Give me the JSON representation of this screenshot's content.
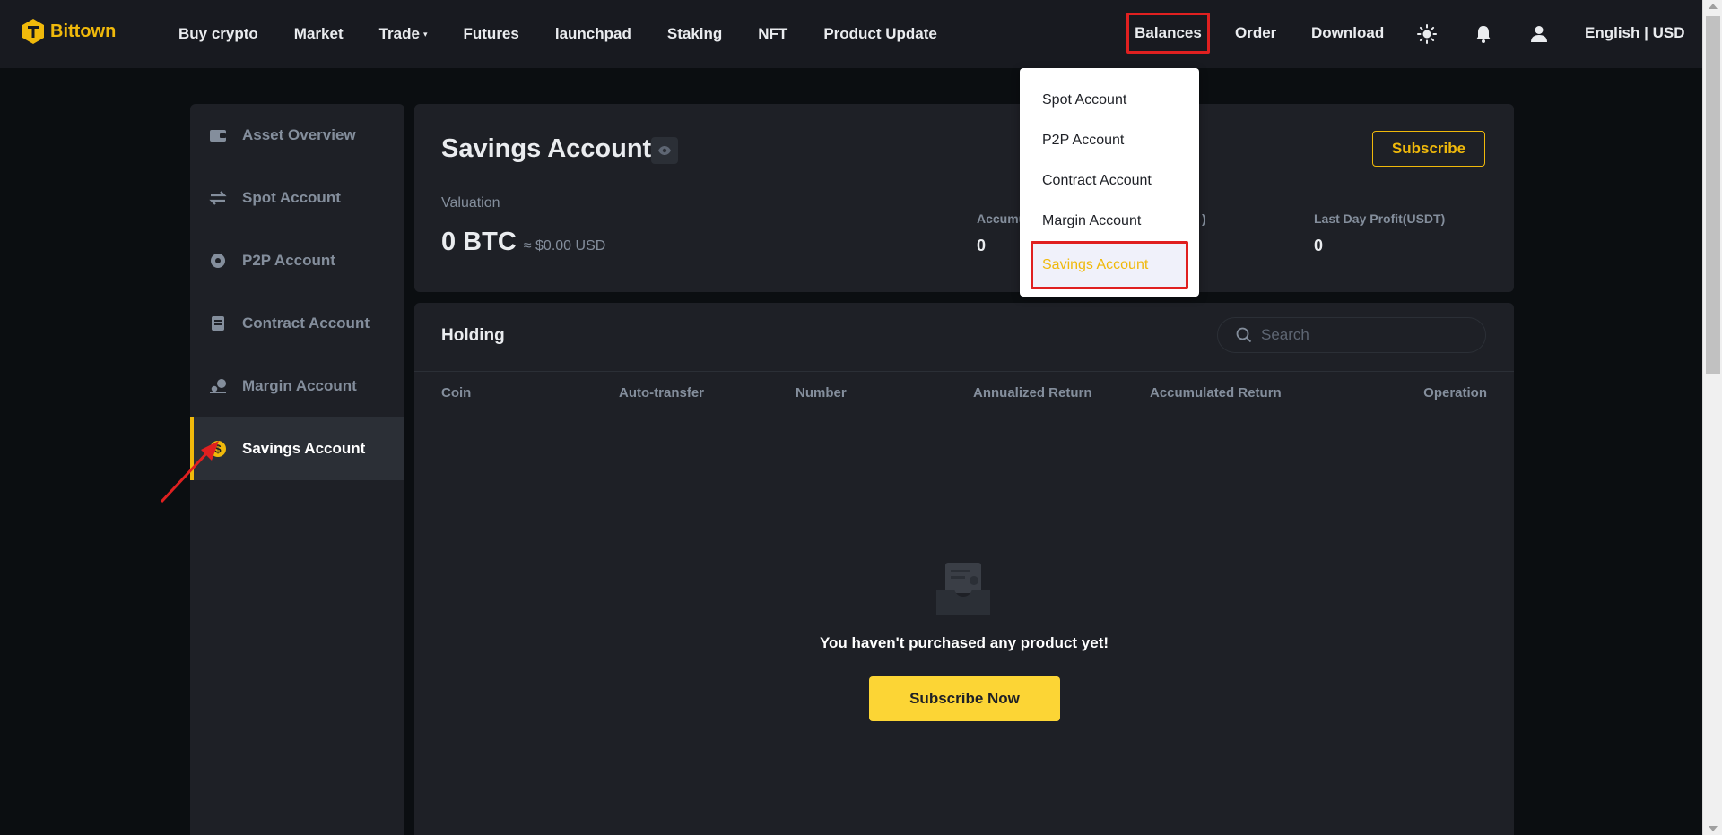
{
  "brand": {
    "name": "Bittown",
    "color": "#f0b90b"
  },
  "nav": {
    "items": [
      "Buy crypto",
      "Market",
      "Trade",
      "Futures",
      "launchpad",
      "Staking",
      "NFT",
      "Product Update"
    ],
    "trade_caret": "▾",
    "right": {
      "balances": "Balances",
      "order": "Order",
      "download": "Download",
      "language": "English | USD"
    },
    "icons": [
      "sun-icon",
      "bell-icon",
      "user-icon"
    ]
  },
  "dropdown": {
    "items": [
      "Spot Account",
      "P2P Account",
      "Contract Account",
      "Margin Account",
      "Savings Account"
    ],
    "active": "Savings Account"
  },
  "sidebar": {
    "items": [
      {
        "label": "Asset Overview",
        "icon": "wallet-icon"
      },
      {
        "label": "Spot Account",
        "icon": "transfer-arrows-icon"
      },
      {
        "label": "P2P Account",
        "icon": "p2p-circle-icon"
      },
      {
        "label": "Contract Account",
        "icon": "document-icon"
      },
      {
        "label": "Margin Account",
        "icon": "margin-icon"
      },
      {
        "label": "Savings Account",
        "icon": "dollar-coin-icon"
      }
    ],
    "active": "Savings Account"
  },
  "summary": {
    "title": "Savings Account",
    "subscribe": "Subscribe",
    "valuation_label": "Valuation",
    "valuation_btc": "0 BTC",
    "valuation_usd": "≈ $0.00 USD",
    "accumulated_label": "Accumu",
    "accumulated_value": "0",
    "hidden_label_tail": ")",
    "last_day_label": "Last Day Profit(USDT)",
    "last_day_value": "0"
  },
  "holding": {
    "title": "Holding",
    "search_placeholder": "Search",
    "columns": [
      "Coin",
      "Auto-transfer",
      "Number",
      "Annualized Return",
      "Accumulated Return",
      "Operation"
    ],
    "empty_text": "You haven't purchased any product yet!",
    "subscribe_now": "Subscribe Now"
  },
  "colors": {
    "accent": "#f0b90b",
    "button_yellow": "#fcd535",
    "annotation_red": "#e02020",
    "bg": "#0b0e11",
    "panel": "#1e2026"
  }
}
